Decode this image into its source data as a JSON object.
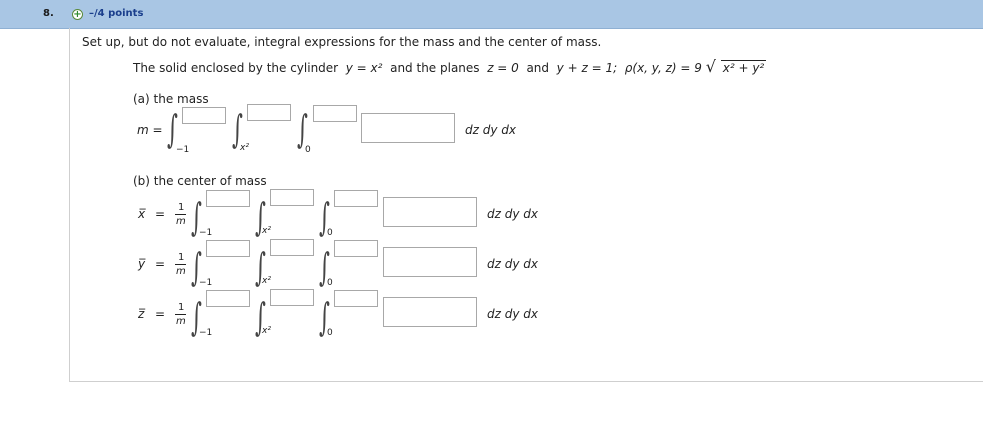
{
  "header": {
    "question_number": "8.",
    "points": "–/4 points"
  },
  "instruction": "Set up, but do not evaluate, integral expressions for the mass and the center of mass.",
  "problem": {
    "lead": "The solid enclosed by the cylinder",
    "cylinder": "y = x²",
    "mid": "and the planes",
    "plane1": "z = 0",
    "and": "and",
    "plane2": "y + z = 1;",
    "density_lhs": "ρ(x, y, z) = 9",
    "sqrt_content": "x² + y²"
  },
  "part_a": {
    "label": "(a) the mass",
    "lhs": "m =",
    "lower_limits": [
      "−1",
      "x²",
      "0"
    ],
    "differentials": "dz dy dx"
  },
  "part_b": {
    "label": "(b) the center of mass",
    "rows": [
      {
        "lhs": "x̅",
        "eq": "=",
        "numerator": "1",
        "denominator": "m",
        "lower_limits": [
          "−1",
          "x²",
          "0"
        ],
        "differentials": "dz dy dx"
      },
      {
        "lhs": "y̅",
        "eq": "=",
        "numerator": "1",
        "denominator": "m",
        "lower_limits": [
          "−1",
          "x²",
          "0"
        ],
        "differentials": "dz dy dx"
      },
      {
        "lhs": "z̅",
        "eq": "=",
        "numerator": "1",
        "denominator": "m",
        "lower_limits": [
          "−1",
          "x²",
          "0"
        ],
        "differentials": "dz dy dx"
      }
    ]
  }
}
